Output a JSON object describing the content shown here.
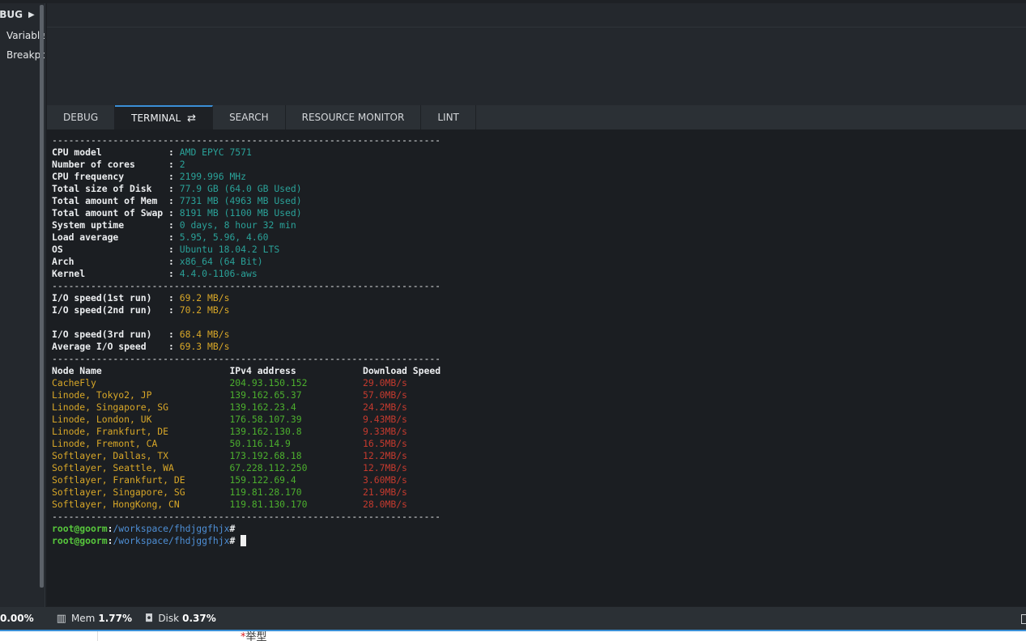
{
  "sidebar": {
    "title": "EBUG",
    "items": [
      "Variable",
      "Breakpo"
    ]
  },
  "tabs": [
    {
      "label": "DEBUG"
    },
    {
      "label": "TERMINAL",
      "icon": "refresh-icon"
    },
    {
      "label": "SEARCH"
    },
    {
      "label": "RESOURCE MONITOR"
    },
    {
      "label": "LINT"
    }
  ],
  "terminal": {
    "separator": "----------------------------------------------------------------------",
    "sysinfo": [
      {
        "key": "CPU model           ",
        "value": "AMD EPYC 7571"
      },
      {
        "key": "Number of cores     ",
        "value": "2"
      },
      {
        "key": "CPU frequency       ",
        "value": "2199.996 MHz"
      },
      {
        "key": "Total size of Disk  ",
        "value": "77.9 GB (64.0 GB Used)"
      },
      {
        "key": "Total amount of Mem ",
        "value": "7731 MB (4963 MB Used)"
      },
      {
        "key": "Total amount of Swap",
        "value": "8191 MB (1100 MB Used)"
      },
      {
        "key": "System uptime       ",
        "value": "0 days, 8 hour 32 min"
      },
      {
        "key": "Load average        ",
        "value": "5.95, 5.96, 4.60"
      },
      {
        "key": "OS                  ",
        "value": "Ubuntu 18.04.2 LTS"
      },
      {
        "key": "Arch                ",
        "value": "x86_64 (64 Bit)"
      },
      {
        "key": "Kernel              ",
        "value": "4.4.0-1106-aws"
      }
    ],
    "io": [
      {
        "key": "I/O speed(1st run)  ",
        "value": "69.2 MB/s"
      },
      {
        "key": "I/O speed(2nd run)  ",
        "value": "70.2 MB/s"
      },
      {
        "key": "",
        "value": ""
      },
      {
        "key": "I/O speed(3rd run)  ",
        "value": "68.4 MB/s"
      },
      {
        "key": "Average I/O speed   ",
        "value": "69.3 MB/s"
      }
    ],
    "nodes_header": {
      "name": "Node Name",
      "ip": "IPv4 address",
      "speed": "Download Speed"
    },
    "nodes": [
      {
        "name": "CacheFly",
        "ip": "204.93.150.152",
        "speed": "29.0MB/s"
      },
      {
        "name": "Linode, Tokyo2, JP",
        "ip": "139.162.65.37",
        "speed": "57.0MB/s"
      },
      {
        "name": "Linode, Singapore, SG",
        "ip": "139.162.23.4",
        "speed": "24.2MB/s"
      },
      {
        "name": "Linode, London, UK",
        "ip": "176.58.107.39",
        "speed": "9.43MB/s"
      },
      {
        "name": "Linode, Frankfurt, DE",
        "ip": "139.162.130.8",
        "speed": "9.33MB/s"
      },
      {
        "name": "Linode, Fremont, CA",
        "ip": "50.116.14.9",
        "speed": "16.5MB/s"
      },
      {
        "name": "Softlayer, Dallas, TX",
        "ip": "173.192.68.18",
        "speed": "12.2MB/s"
      },
      {
        "name": "Softlayer, Seattle, WA",
        "ip": "67.228.112.250",
        "speed": "12.7MB/s"
      },
      {
        "name": "Softlayer, Frankfurt, DE",
        "ip": "159.122.69.4",
        "speed": "3.60MB/s"
      },
      {
        "name": "Softlayer, Singapore, SG",
        "ip": "119.81.28.170",
        "speed": "21.9MB/s"
      },
      {
        "name": "Softlayer, HongKong, CN",
        "ip": "119.81.130.170",
        "speed": "28.0MB/s"
      }
    ],
    "prompts": [
      {
        "user": "root@goorm",
        "path": "/workspace/fhdjggfhjx",
        "symbol": "#"
      },
      {
        "user": "root@goorm",
        "path": "/workspace/fhdjggfhjx",
        "symbol": "#"
      }
    ]
  },
  "statusbar": {
    "cpu_value": "0.00%",
    "mem_label": "Mem",
    "mem_value": "1.77%",
    "disk_label": "Disk",
    "disk_value": "0.37%"
  },
  "bottom": {
    "label": "举型"
  },
  "colors": {
    "accent": "#3b8fd6",
    "value_cyan": "#2aa198",
    "value_yellow": "#d8a728",
    "value_green": "#4caf2e",
    "value_red": "#c43a2e"
  }
}
